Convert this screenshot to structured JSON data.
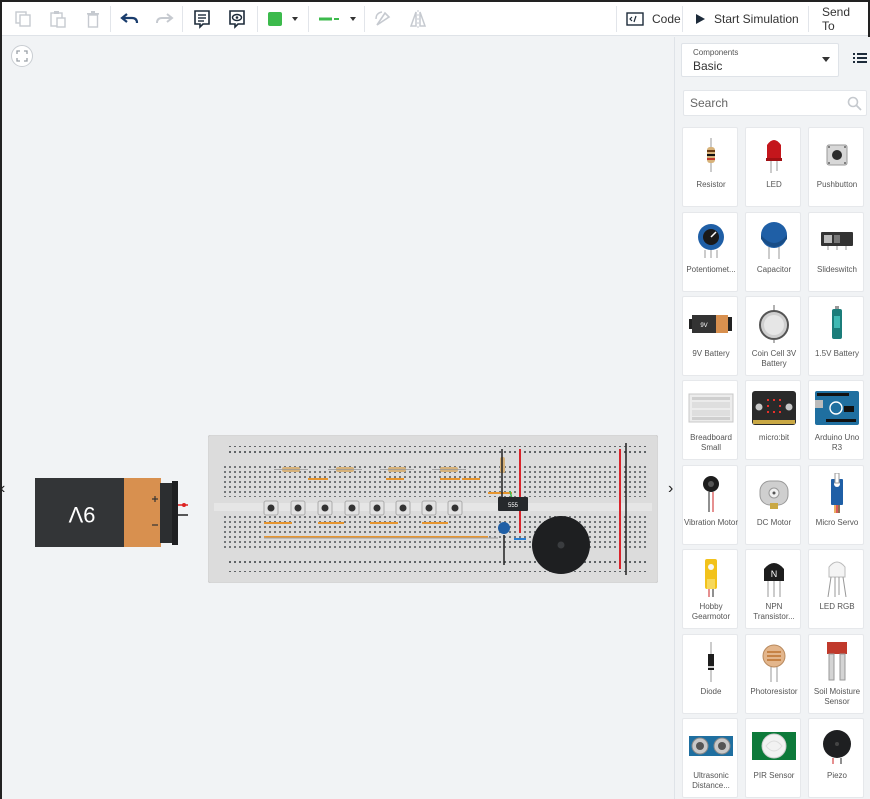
{
  "toolbar": {
    "code_label": "Code",
    "start_sim_label": "Start Simulation",
    "send_to_label": "Send To",
    "fill_color": "#3cba4c",
    "wire_color": "#3cba4c"
  },
  "canvas": {
    "battery_label": "9V",
    "chip_label": "555"
  },
  "sidebar": {
    "components_caption": "Components",
    "components_value": "Basic",
    "search_placeholder": "Search",
    "tiles": [
      {
        "label": "Resistor",
        "icon": "resistor-icon"
      },
      {
        "label": "LED",
        "icon": "led-icon"
      },
      {
        "label": "Pushbutton",
        "icon": "pushbutton-icon"
      },
      {
        "label": "Potentiomet...",
        "icon": "potentiometer-icon"
      },
      {
        "label": "Capacitor",
        "icon": "capacitor-icon"
      },
      {
        "label": "Slideswitch",
        "icon": "slideswitch-icon"
      },
      {
        "label": "9V Battery",
        "icon": "battery-9v-icon"
      },
      {
        "label": "Coin Cell 3V Battery",
        "icon": "coin-cell-icon"
      },
      {
        "label": "1.5V Battery",
        "icon": "battery-aa-icon"
      },
      {
        "label": "Breadboard Small",
        "icon": "breadboard-icon"
      },
      {
        "label": "micro:bit",
        "icon": "microbit-icon"
      },
      {
        "label": "Arduino Uno R3",
        "icon": "arduino-icon"
      },
      {
        "label": "Vibration Motor",
        "icon": "vibration-motor-icon"
      },
      {
        "label": "DC Motor",
        "icon": "dc-motor-icon"
      },
      {
        "label": "Micro Servo",
        "icon": "micro-servo-icon"
      },
      {
        "label": "Hobby Gearmotor",
        "icon": "gearmotor-icon"
      },
      {
        "label": "NPN Transistor...",
        "icon": "npn-transistor-icon"
      },
      {
        "label": "LED RGB",
        "icon": "led-rgb-icon"
      },
      {
        "label": "Diode",
        "icon": "diode-icon"
      },
      {
        "label": "Photoresistor",
        "icon": "photoresistor-icon"
      },
      {
        "label": "Soil Moisture Sensor",
        "icon": "soil-moisture-icon"
      },
      {
        "label": "Ultrasonic Distance...",
        "icon": "ultrasonic-icon"
      },
      {
        "label": "PIR Sensor",
        "icon": "pir-sensor-icon"
      },
      {
        "label": "Piezo",
        "icon": "piezo-icon"
      }
    ]
  }
}
